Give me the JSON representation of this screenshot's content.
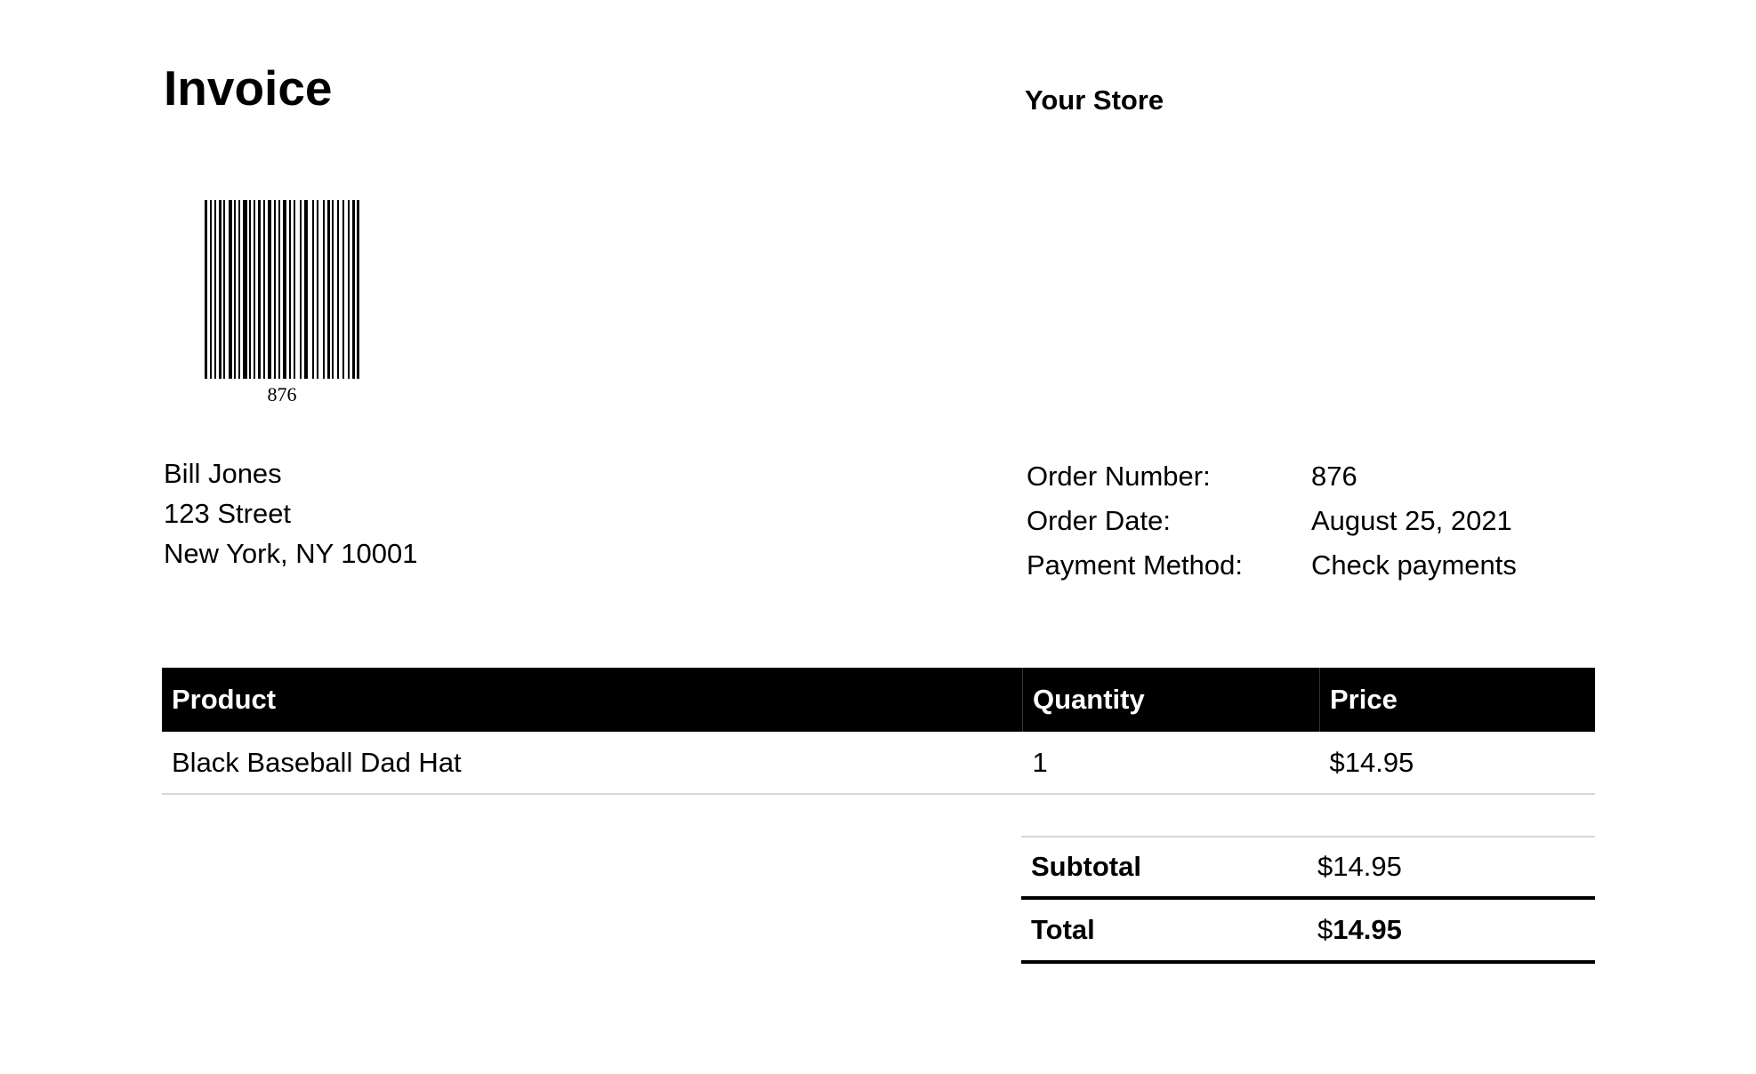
{
  "header": {
    "title": "Invoice",
    "store_name": "Your Store"
  },
  "barcode": {
    "number": "876"
  },
  "customer": {
    "name": "Bill Jones",
    "street": "123 Street",
    "city_line": "New York, NY 10001"
  },
  "order": {
    "number_label": "Order Number:",
    "number_value": "876",
    "date_label": "Order Date:",
    "date_value": "August 25, 2021",
    "payment_label": "Payment Method:",
    "payment_value": "Check payments"
  },
  "items_table": {
    "headers": {
      "product": "Product",
      "quantity": "Quantity",
      "price": "Price"
    },
    "rows": [
      {
        "product": "Black Baseball Dad Hat",
        "quantity": "1",
        "price": "$14.95"
      }
    ]
  },
  "totals": {
    "subtotal_label": "Subtotal",
    "subtotal_value": "$14.95",
    "total_label": "Total",
    "total_currency": "$",
    "total_amount": "14.95"
  }
}
